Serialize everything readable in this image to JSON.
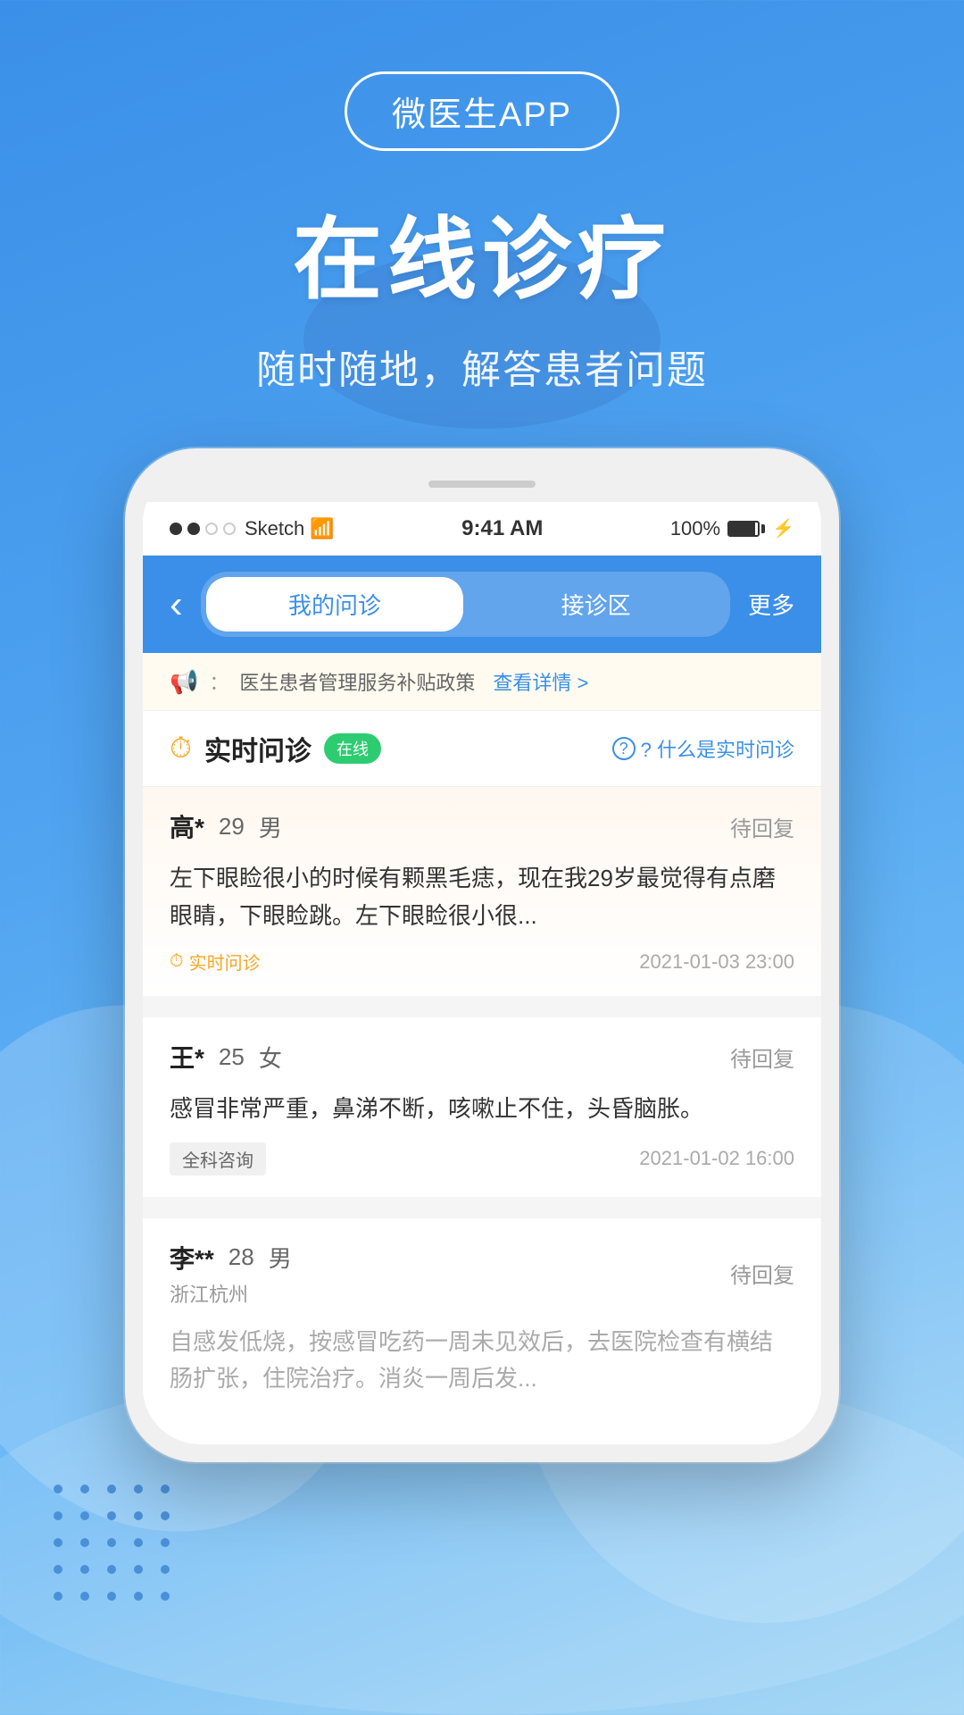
{
  "app": {
    "badge_text": "微医生APP",
    "main_title": "在线诊疗",
    "sub_title": "随时随地，解答患者问题"
  },
  "phone": {
    "status_bar": {
      "carrier": "Sketch",
      "wifi_icon": "WiFi",
      "time": "9:41 AM",
      "battery": "100%"
    },
    "header": {
      "back_icon": "‹",
      "tab1": "我的问诊",
      "tab2": "接诊区",
      "more": "更多"
    },
    "notice": {
      "text": "医生患者管理服务补贴政策",
      "link_text": "查看详情 >"
    },
    "realtime_section": {
      "icon": "↺",
      "label": "实时问诊",
      "badge": "在线",
      "help_text": "? 什么是实时问诊"
    },
    "patients": [
      {
        "name": "高*",
        "age": "29",
        "gender": "男",
        "location": "",
        "status": "待回复",
        "desc": "左下眼睑很小的时候有颗黑毛痣，现在我29岁最觉得有点磨眼睛，下眼睑跳。左下眼睑很小很...",
        "tag": "实时问诊",
        "tag_type": "realtime",
        "time": "2021-01-03 23:00",
        "highlight": true
      },
      {
        "name": "王*",
        "age": "25",
        "gender": "女",
        "location": "",
        "status": "待回复",
        "desc": "感冒非常严重，鼻涕不断，咳嗽止不住，头昏脑胀。",
        "tag": "全科咨询",
        "tag_type": "gray",
        "time": "2021-01-02 16:00",
        "highlight": false
      },
      {
        "name": "李**",
        "age": "28",
        "gender": "男",
        "location": "浙江杭州",
        "status": "待回复",
        "desc": "自感发低烧，按感冒吃药一周未见效后，去医院检查有横结肠扩张，住院治疗。消炎一周后发...",
        "tag": "",
        "tag_type": "none",
        "time": "",
        "highlight": false,
        "dimmed": true
      }
    ]
  },
  "icons": {
    "back": "‹",
    "clock": "⏱",
    "question": "?",
    "speaker": "📢",
    "dot_filled": "●",
    "dot_empty": "○"
  }
}
